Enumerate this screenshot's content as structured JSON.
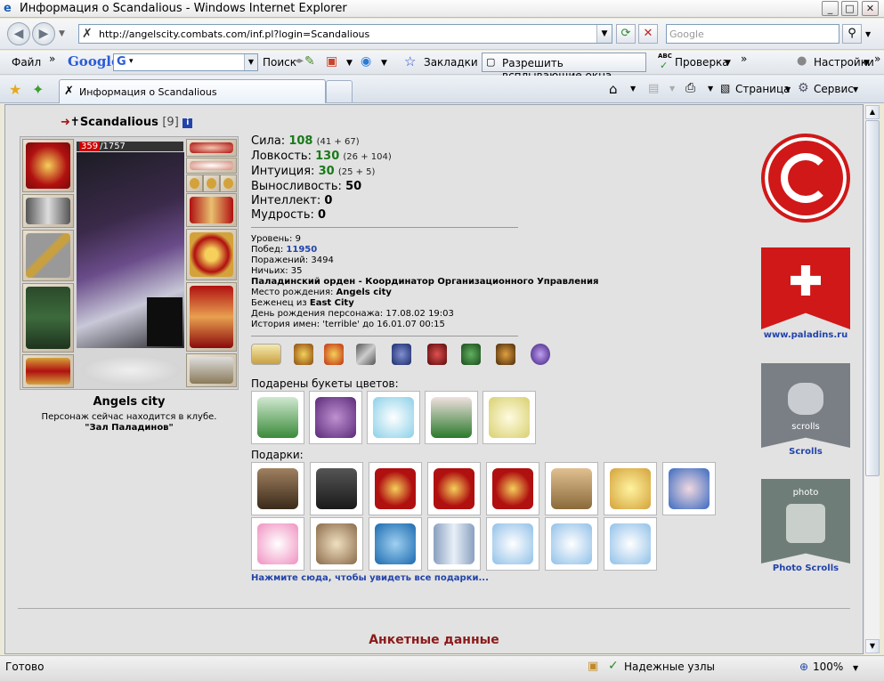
{
  "window": {
    "title": "Информация о Scandalious - Windows Internet Explorer",
    "minimize": "_",
    "maximize": "□",
    "close": "✕"
  },
  "nav": {
    "address": "http://angelscity.combats.com/inf.pl?login=Scandalious",
    "search_placeholder": "Google"
  },
  "google_toolbar": {
    "file_menu": "Файл",
    "logo": "Google",
    "combo_letter": "G",
    "search_label": "Поиск",
    "bookmarks": "Закладки",
    "popups": "Разрешить всплывающие окна",
    "spellcheck": "Проверка",
    "spellcheck_abc": "ABC",
    "settings": "Настройки",
    "more": "»"
  },
  "tabs": {
    "active_tab": "Информация о Scandalious"
  },
  "commands": {
    "page": "Страница",
    "service": "Сервис"
  },
  "character": {
    "nick": "Scandalious",
    "level_badge": "[9]",
    "hp_current": "359",
    "hp_max": "/1757",
    "city": "Angels city",
    "location_text": "Персонаж сейчас находится в клубе.",
    "location_place": "\"Зал Паладинов\""
  },
  "stats": {
    "strength_label": "Сила:",
    "strength_value": "108",
    "strength_detail": "(41 + 67)",
    "agility_label": "Ловкость:",
    "agility_value": "130",
    "agility_detail": "(26 + 104)",
    "intuition_label": "Интуиция:",
    "intuition_value": "30",
    "intuition_detail": "(25 + 5)",
    "endurance_label": "Выносливость:",
    "endurance_value": "50",
    "intellect_label": "Интеллект:",
    "intellect_value": "0",
    "wisdom_label": "Мудрость:",
    "wisdom_value": "0"
  },
  "details": {
    "level": "Уровень: 9",
    "wins_label": "Побед: ",
    "wins_value": "11950",
    "losses": "Поражений: 3494",
    "draws": "Ничьих: 35",
    "order": "Паладинский орден - Координатор Организационного Управления",
    "birthplace_label": "Место рождения: ",
    "birthplace_value": "Angels city",
    "refugee_label": "Беженец из ",
    "refugee_value": "East City",
    "birthday": "День рождения персонажа: 17.08.02 19:03",
    "name_history": "История имен: 'terrible' до 16.01.07 00:15"
  },
  "sections": {
    "flowers_label": "Подарены букеты цветов:",
    "gifts_label": "Подарки:",
    "see_all_gifts": "Нажмите сюда, чтобы увидеть все подарки...",
    "profile_header": "Анкетные данные"
  },
  "sidebar": {
    "paladins_link": "www.paladins.ru",
    "scrolls": "Scrolls",
    "scrolls_banner": "scrolls",
    "photo_scrolls": "Photo Scrolls",
    "photo_banner": "photo"
  },
  "status": {
    "ready": "Готово",
    "zone": "Надежные узлы",
    "zoom": "100%"
  },
  "colors": {
    "stat_green": "#1a7a1a",
    "link_blue": "#2244aa",
    "header_red": "#8b1a1a",
    "logo_red": "#d01818"
  }
}
